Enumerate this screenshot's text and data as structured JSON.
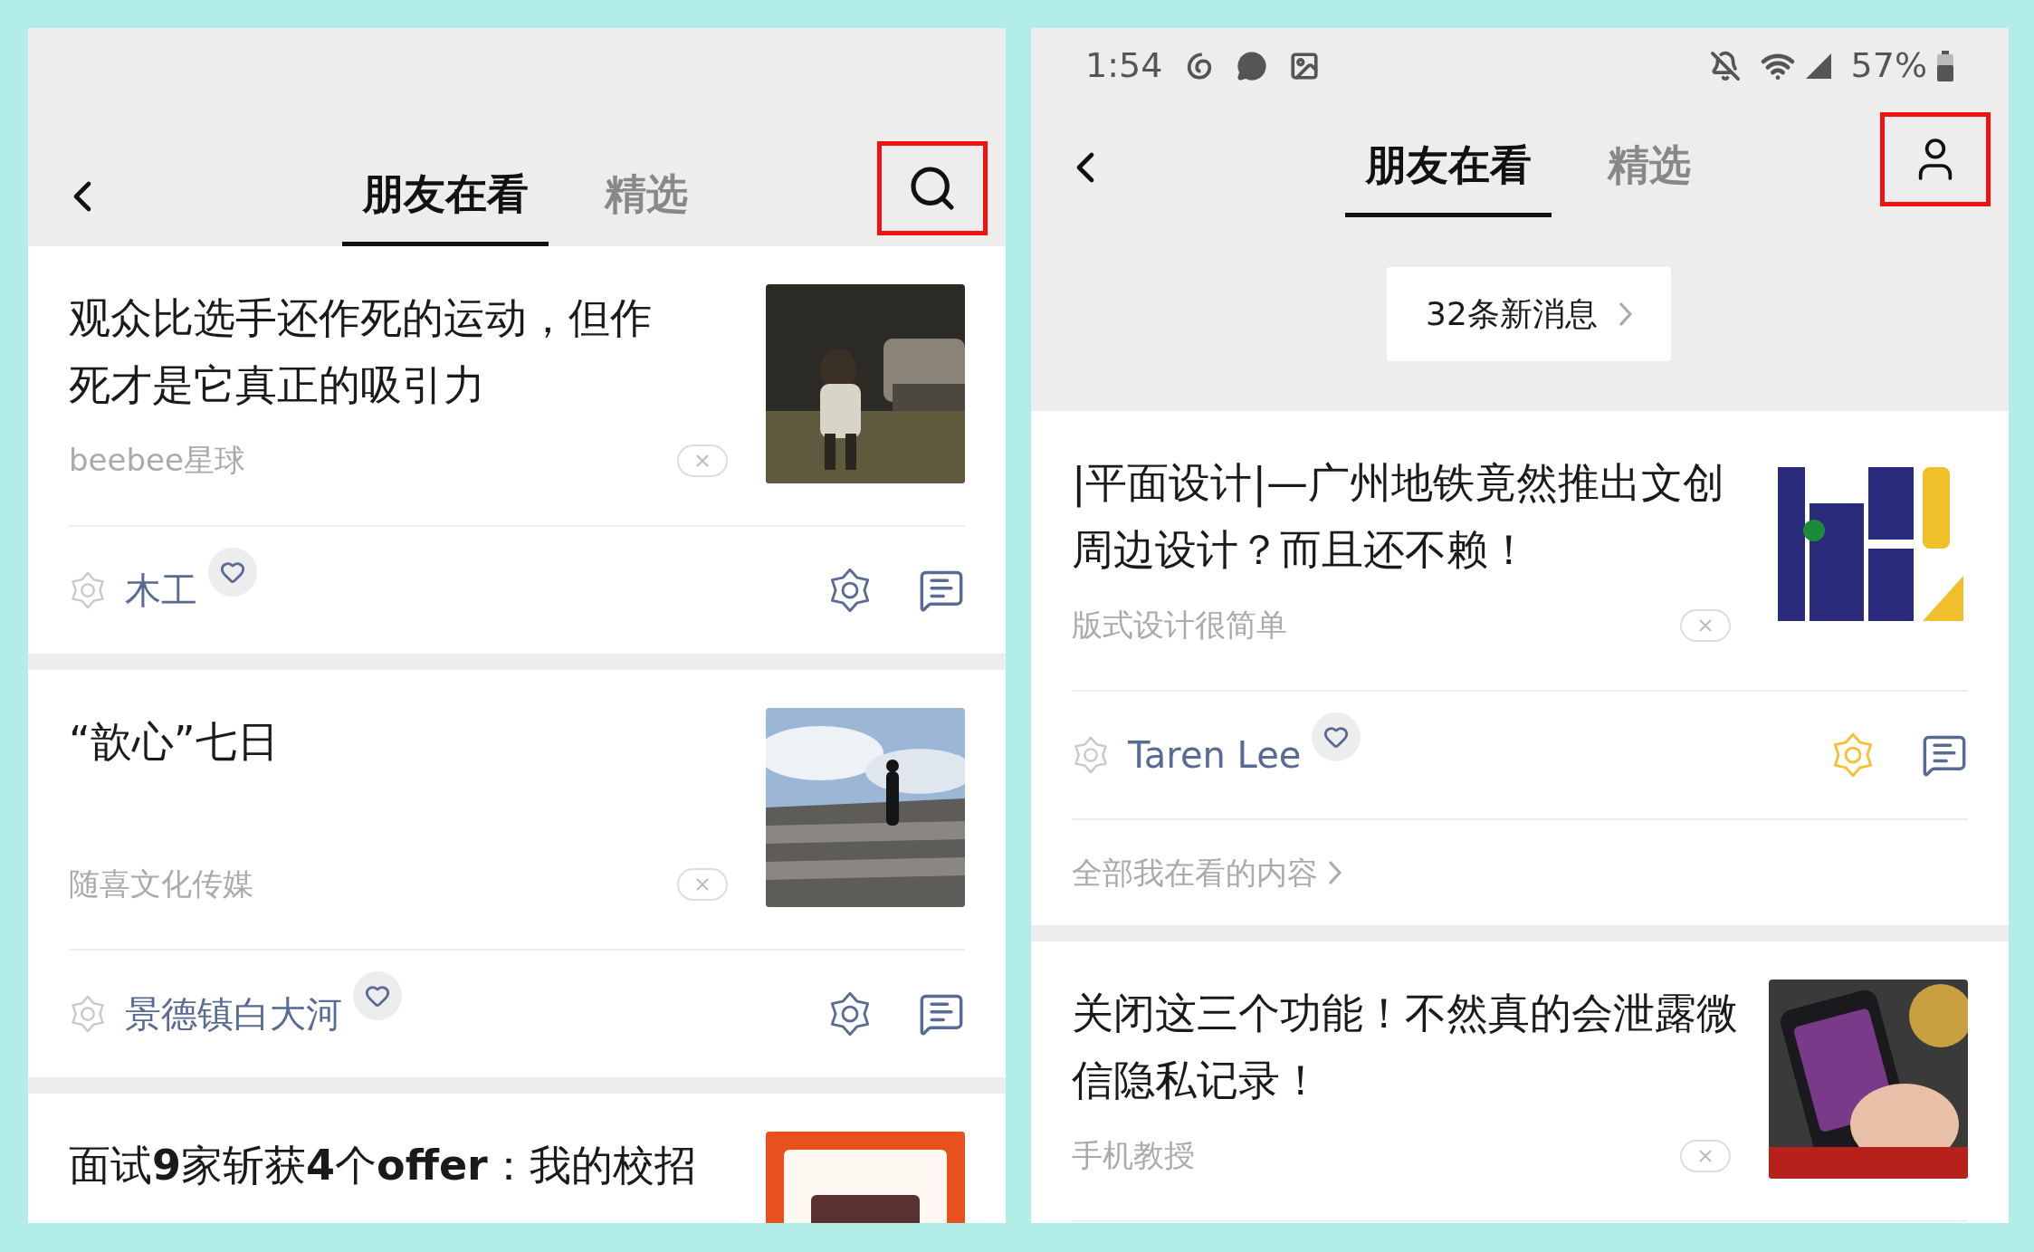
{
  "screens": [
    {
      "header": {
        "tabs": [
          {
            "label": "朋友在看",
            "selected": true
          },
          {
            "label": "精选",
            "selected": false
          }
        ],
        "action": {
          "kind": "search"
        }
      },
      "feed": [
        {
          "title": "观众比选手还作死的运动，但作死才是它真正的吸引力",
          "source": "beebee星球",
          "reactions": {
            "names": [
              "木工"
            ],
            "wowed": false
          }
        },
        {
          "title": "“歆心”七日",
          "source": "随喜文化传媒",
          "reactions": {
            "names": [
              "景德镇白大河"
            ],
            "wowed": false
          }
        },
        {
          "title": "面试**9**家斩获**4**个**offer**：我的校招"
        }
      ]
    },
    {
      "status_bar": {
        "time": "1:54",
        "battery": "57%"
      },
      "header": {
        "tabs": [
          {
            "label": "朋友在看",
            "selected": true
          },
          {
            "label": "精选",
            "selected": false
          }
        ],
        "action": {
          "kind": "profile"
        }
      },
      "new_messages": "32条新消息",
      "feed": [
        {
          "title": "|平面设计|—广州地铁竟然推出文创周边设计？而且还不赖！",
          "source": "版式设计很简单",
          "reactions": {
            "names": [
              "Taren Lee"
            ],
            "wowed": true
          },
          "more_link": "全部我在看的内容"
        },
        {
          "title": "关闭这三个功能！不然真的会泄露微信隐私记录！",
          "source": "手机教授"
        }
      ]
    }
  ]
}
